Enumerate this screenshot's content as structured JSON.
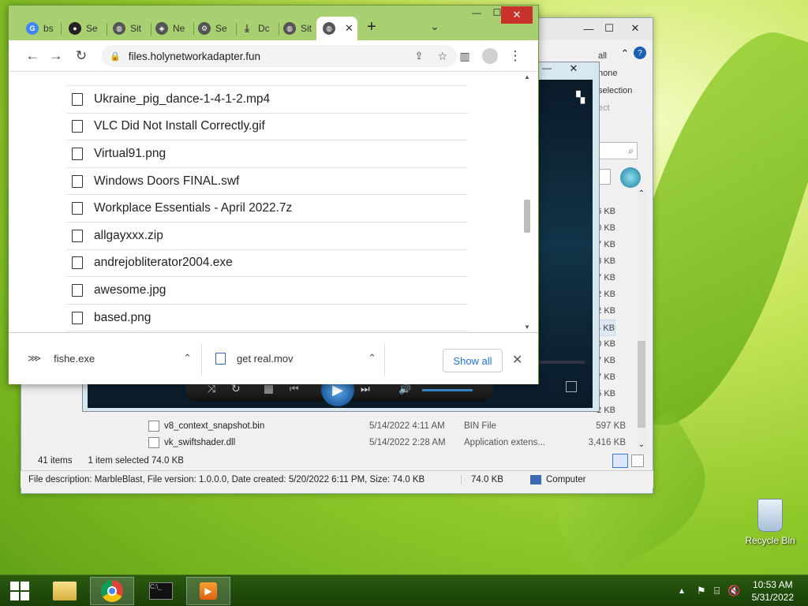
{
  "chrome": {
    "tabs": [
      {
        "label": "bs",
        "icon": "google-icon"
      },
      {
        "label": "Se",
        "icon": "github-icon"
      },
      {
        "label": "Sit",
        "icon": "globe-icon"
      },
      {
        "label": "Ne",
        "icon": "ne-icon"
      },
      {
        "label": "Se",
        "icon": "gear-icon"
      },
      {
        "label": "Dc",
        "icon": "download-icon"
      },
      {
        "label": "Sit",
        "icon": "globe-icon"
      }
    ],
    "url": "files.holynetworkadapter.fun",
    "files": [
      "Ukraine_pig_dance-1-4-1-2.mp4",
      "VLC Did Not Install Correctly.gif",
      "Virtual91.png",
      "Windows Doors FINAL.swf",
      "Workplace Essentials - April 2022.7z",
      "allgayxxx.zip",
      "andrejobliterator2004.exe",
      "awesome.jpg",
      "based.png"
    ],
    "downloads": [
      {
        "name": "fishe.exe"
      },
      {
        "name": "get real.mov"
      }
    ],
    "show_all": "Show all"
  },
  "explorer": {
    "side_labels": [
      "all",
      "none",
      "selection",
      "ect"
    ],
    "sizes": [
      "6 KB",
      "0 KB",
      "7 KB",
      "3 KB",
      "7 KB",
      "2 KB",
      "2 KB",
      "4 KB",
      "0 KB",
      "7 KB",
      "7 KB",
      "5 KB",
      "2 KB"
    ],
    "files": [
      {
        "name": "v8_context_snapshot.bin",
        "date": "5/14/2022 4:11 AM",
        "type": "BIN File",
        "size": "597 KB"
      },
      {
        "name": "vk_swiftshader.dll",
        "date": "5/14/2022 2:28 AM",
        "type": "Application extens...",
        "size": "3,416 KB"
      }
    ],
    "item_count": "41 items",
    "selected": "1 item selected  74.0 KB",
    "status_description": "File description: MarbleBlast, File version: 1.0.0.0, Date created: 5/20/2022 6:11 PM, Size: 74.0 KB",
    "status_size": "74.0 KB",
    "status_location": "Computer"
  },
  "desktop": {
    "recycle_bin": "Recycle Bin"
  },
  "taskbar": {
    "time": "10:53 AM",
    "date": "5/31/2022"
  }
}
